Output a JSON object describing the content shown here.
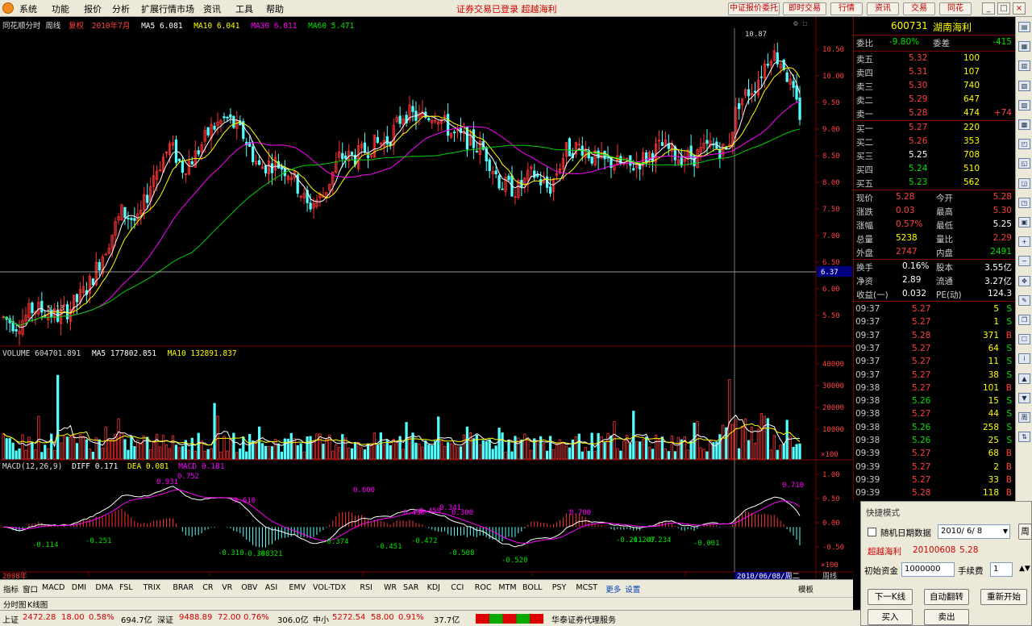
{
  "menu": {
    "items": [
      "系统",
      "功能",
      "报价",
      "分析",
      "扩展行情市场",
      "资讯",
      "工具",
      "帮助"
    ],
    "marquee": "证券交易已登录 超越海利",
    "top_buttons": [
      "中证报价委托",
      "即时交易",
      "行情",
      "资讯",
      "交易",
      "同花"
    ],
    "win_buttons": [
      "_",
      "□",
      "×"
    ]
  },
  "legends": {
    "main": {
      "title": "同花顺分时 周线",
      "tag": "复权",
      "code": "2010年7月",
      "ma5": "MA5 6.081",
      "ma10": "MA10 6.041",
      "ma30": "MA30 6.011",
      "ma60": "MA60 5.471"
    },
    "volume": {
      "title": "VOLUME 604701.891",
      "ma5": "MA5 177802.851",
      "ma10": "MA10 132891.837"
    },
    "macd": {
      "title": "MACD(12,26,9)",
      "diff": "DIFF 0.171",
      "dea": "DEA 0.081",
      "macd": "MACD 0.181"
    }
  },
  "axis": {
    "price_ticks": [
      "10.50",
      "10.00",
      "9.50",
      "9.00",
      "8.50",
      "8.00",
      "7.50",
      "7.00",
      "6.50",
      "6.00",
      "5.50"
    ],
    "price_mark": "6.37",
    "peak_label": "10.87",
    "low_label": "5.13",
    "volume_ticks": [
      "40000",
      "30000",
      "20000",
      "10000"
    ],
    "vol_unit": "×100",
    "macd_ticks": [
      "1.00",
      "0.50",
      "0.00",
      "-0.50"
    ],
    "macd_unit": "×100",
    "date_left": "2008年",
    "date_cursor": "2010/06/08/周二",
    "corner": "周线"
  },
  "macd_labels": [
    "0.931",
    "0.752",
    "0.610",
    "0.600",
    "0.438",
    "0.459",
    "0.341",
    "0.300",
    "0.700",
    "-0.114",
    "-0.251",
    "-0.310",
    "-0.308",
    "-0.321",
    "-0.451",
    "-0.374",
    "-0.472",
    "-0.508",
    "-0.520",
    "-0.211",
    "-0.207",
    "-0.234",
    "-0.001",
    "0.710"
  ],
  "quote": {
    "code": "600731",
    "name": "湖南海利",
    "weibi_label": "委比",
    "weibi_value": "-9.80%",
    "weicha_label": "委差",
    "weicha_value": "-415",
    "asks": [
      {
        "label": "卖五",
        "price": "5.32",
        "vol": "100"
      },
      {
        "label": "卖四",
        "price": "5.31",
        "vol": "107"
      },
      {
        "label": "卖三",
        "price": "5.30",
        "vol": "740"
      },
      {
        "label": "卖二",
        "price": "5.29",
        "vol": "647"
      },
      {
        "label": "卖一",
        "price": "5.28",
        "vol": "474",
        "extra": "+74"
      }
    ],
    "bids": [
      {
        "label": "买一",
        "price": "5.27",
        "vol": "220"
      },
      {
        "label": "买二",
        "price": "5.26",
        "vol": "353"
      },
      {
        "label": "买三",
        "price": "5.25",
        "vol": "708"
      },
      {
        "label": "买四",
        "price": "5.24",
        "vol": "510"
      },
      {
        "label": "买五",
        "price": "5.23",
        "vol": "562"
      }
    ],
    "stats": [
      {
        "l1": "现价",
        "v1": "5.28",
        "l2": "今开",
        "v2": "5.28"
      },
      {
        "l1": "涨跌",
        "v1": "0.03",
        "l2": "最高",
        "v2": "5.30"
      },
      {
        "l1": "涨幅",
        "v1": "0.57%",
        "l2": "最低",
        "v2": "5.25"
      },
      {
        "l1": "总量",
        "v1": "5238",
        "l2": "量比",
        "v2": "2.29"
      },
      {
        "l1": "外盘",
        "v1": "2747",
        "l2": "内盘",
        "v2": "2491"
      }
    ],
    "stats2": [
      {
        "l1": "换手",
        "v1": "0.16%",
        "l2": "股本",
        "v2": "3.55亿"
      },
      {
        "l1": "净资",
        "v1": "2.89",
        "l2": "流通",
        "v2": "3.27亿"
      },
      {
        "l1": "收益(一)",
        "v1": "0.032",
        "l2": "PE(动)",
        "v2": "124.3"
      }
    ],
    "ticks": [
      {
        "time": "09:37",
        "price": "5.27",
        "vol": "5",
        "side": "S"
      },
      {
        "time": "09:37",
        "price": "5.27",
        "vol": "1",
        "side": "S"
      },
      {
        "time": "09:37",
        "price": "5.28",
        "vol": "371",
        "side": "B"
      },
      {
        "time": "09:37",
        "price": "5.27",
        "vol": "64",
        "side": "S"
      },
      {
        "time": "09:37",
        "price": "5.27",
        "vol": "11",
        "side": "S"
      },
      {
        "time": "09:37",
        "price": "5.27",
        "vol": "38",
        "side": "S"
      },
      {
        "time": "09:38",
        "price": "5.27",
        "vol": "101",
        "side": "B"
      },
      {
        "time": "09:38",
        "price": "5.26",
        "vol": "15",
        "side": "S"
      },
      {
        "time": "09:38",
        "price": "5.27",
        "vol": "44",
        "side": "S"
      },
      {
        "time": "09:38",
        "price": "5.26",
        "vol": "258",
        "side": "S"
      },
      {
        "time": "09:38",
        "price": "5.26",
        "vol": "25",
        "side": "S"
      },
      {
        "time": "09:39",
        "price": "5.27",
        "vol": "68",
        "side": "B"
      },
      {
        "time": "09:39",
        "price": "5.27",
        "vol": "2",
        "side": "B"
      },
      {
        "time": "09:39",
        "price": "5.27",
        "vol": "33",
        "side": "B"
      },
      {
        "time": "09:39",
        "price": "5.28",
        "vol": "118",
        "side": "B"
      }
    ]
  },
  "indicator_tabs": [
    "指标",
    "窗口",
    "MACD",
    "DMI",
    "DMA",
    "FSL",
    "TRIX",
    "BRAR",
    "CR",
    "VR",
    "OBV",
    "ASI",
    "EMV",
    "VOL-TDX",
    "RSI",
    "WR",
    "SAR",
    "KDJ",
    "CCI",
    "ROC",
    "MTM",
    "BOLL",
    "PSY",
    "MCST",
    "更多",
    "设置"
  ],
  "indicator_right": "模板",
  "sub_tabs": [
    "分时图",
    "K线图"
  ],
  "status": {
    "sh_label": "上证",
    "sh_val": "2472.28",
    "sh_chg": "18.00",
    "sh_pct": "0.58%",
    "sh_amt": "694.7亿",
    "sz_label": "深证",
    "sz_val": "9488.89",
    "sz_chg": "72.00",
    "sz_pct": "0.76%",
    "sz_amt": "306.0亿",
    "zx_label": "中小",
    "zx_val": "5272.54",
    "zx_chg": "58.00",
    "zx_pct": "0.91%",
    "zx_amt": "37.7亿",
    "broker": "华泰证券代理服务"
  },
  "dialog": {
    "title": "快捷模式",
    "checkbox_label": "随机日期数据",
    "date_value": "2010/ 6/ 8",
    "date_btn": "周",
    "stock_label": "超越海利",
    "stock_date": "20100608",
    "stock_price": "5.28",
    "fund_label": "初始资金",
    "fund_value": "1000000",
    "lot_label": "手续费",
    "lot_value": "1",
    "btn_next": "下一K线",
    "btn_auto": "自动翻转",
    "btn_restart": "重新开始",
    "btn_buy": "买入",
    "btn_sell": "卖出"
  },
  "sidebar_icons": [
    "chart-icon",
    "table-icon",
    "news-icon",
    "list-icon",
    "calendar-icon",
    "compare-icon",
    "alarm-icon",
    "grid-icon",
    "kline-icon",
    "f10-icon",
    "layout-icon",
    "plus-icon",
    "minus-icon",
    "arrows-icon",
    "pen-icon",
    "window-icon",
    "bell-icon",
    "info-icon",
    "up-icon",
    "down-icon",
    "week-icon",
    "sort-icon"
  ],
  "chart_data": {
    "type": "candlestick",
    "panels": [
      "price",
      "volume",
      "macd"
    ],
    "price_range": [
      5.3,
      10.8
    ],
    "volume_range": [
      0,
      45000
    ],
    "macd_range": [
      -0.6,
      1.1
    ],
    "colors": {
      "up": "#ff3232",
      "down": "#54ffff",
      "ma5": "#ffffff",
      "ma10": "#ffff00",
      "ma30": "#ff00ff",
      "ma60": "#00d000"
    }
  }
}
